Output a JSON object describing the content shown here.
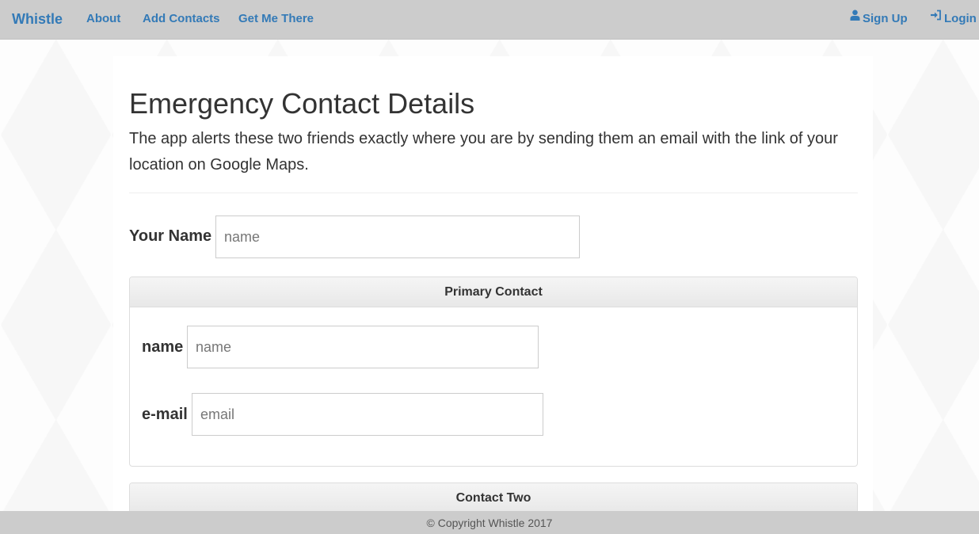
{
  "navbar": {
    "brand": "Whistle",
    "links": [
      "About",
      "Add Contacts",
      "Get Me There"
    ],
    "right": {
      "signup": {
        "label": "Sign Up",
        "icon": "user-icon"
      },
      "login": {
        "label": "Login",
        "icon": "login-icon"
      }
    },
    "link_color": "#337ab7"
  },
  "main": {
    "title": "Emergency Contact Details",
    "lead": "The app alerts these two friends exactly where you are by sending them an email with the link of your location on Google Maps.",
    "your_name": {
      "label": "Your Name",
      "placeholder": "name"
    },
    "primary_contact": {
      "heading": "Primary Contact",
      "name": {
        "label": "name",
        "placeholder": "name"
      },
      "email": {
        "label": "e-mail",
        "placeholder": "email"
      }
    },
    "contact_two": {
      "heading": "Contact Two"
    }
  },
  "footer": {
    "text": "© Copyright Whistle 2017"
  }
}
